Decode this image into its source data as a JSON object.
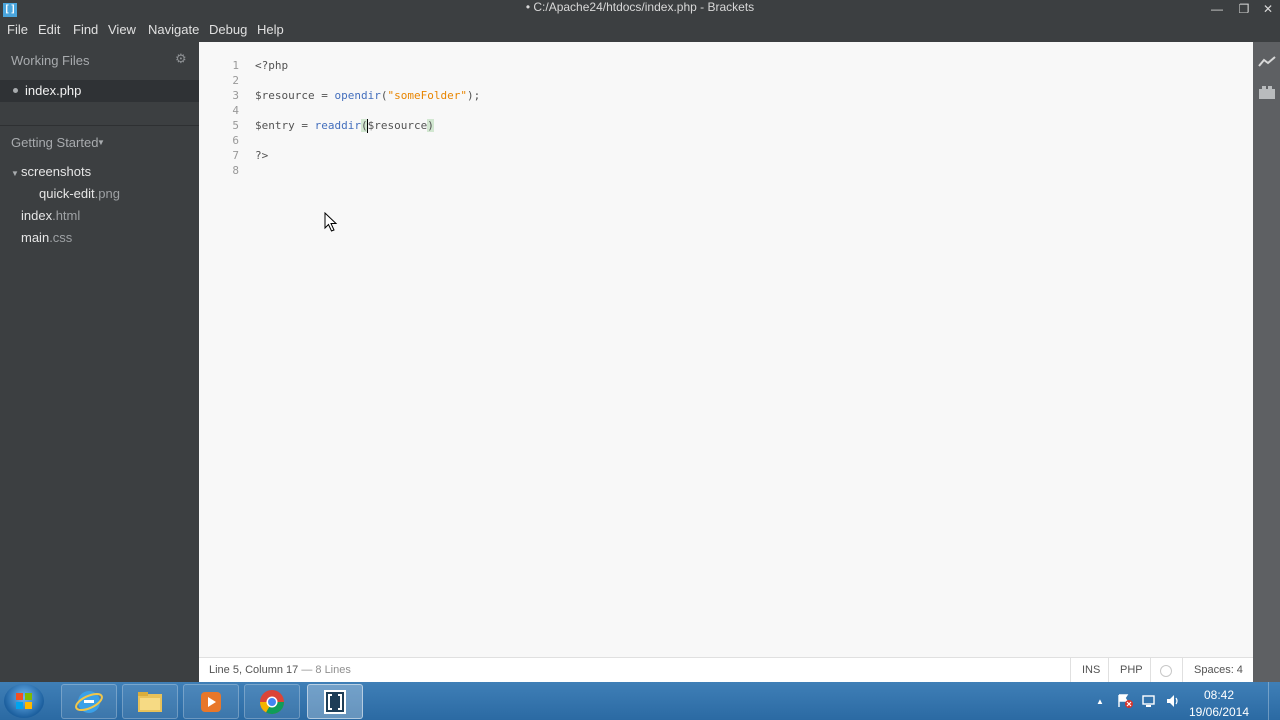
{
  "window": {
    "title": "• C:/Apache24/htdocs/index.php - Brackets",
    "logo_glyph": "[]",
    "minimize_glyph": "—",
    "maximize_glyph": "❐",
    "close_glyph": "✕"
  },
  "menu": [
    "File",
    "Edit",
    "Find",
    "View",
    "Navigate",
    "Debug",
    "Help"
  ],
  "sidebar": {
    "working_files_title": "Working Files",
    "gear_glyph": "⚙",
    "working_files": [
      {
        "name": "index.php",
        "selected": true
      }
    ],
    "project_title": "Getting Started",
    "project_caret": "▼",
    "tree": [
      {
        "base": "screenshots",
        "ext": "",
        "type": "folder",
        "caret": "▼"
      },
      {
        "base": "quick-edit",
        "ext": ".png",
        "type": "file"
      },
      {
        "base": "index",
        "ext": ".html",
        "type": "file"
      },
      {
        "base": "main",
        "ext": ".css",
        "type": "file"
      }
    ]
  },
  "editor": {
    "line_numbers": [
      "1",
      "2",
      "3",
      "4",
      "5",
      "6",
      "7",
      "8"
    ],
    "lines": {
      "l1": "<?php",
      "l3_var": "$resource",
      "l3_eq": " = ",
      "l3_fn": "opendir",
      "l3_open": "(",
      "l3_str": "\"someFolder\"",
      "l3_close": ");",
      "l5_var": "$entry",
      "l5_eq": " = ",
      "l5_fn": "readdir",
      "l5_open": "(",
      "l5_arg": "$resource",
      "l5_close": ")",
      "l7": "?>"
    }
  },
  "statusbar": {
    "position": "Line 5, Column 17",
    "lines": " — 8 Lines",
    "mode": "INS",
    "language": "PHP",
    "indent": "Spaces: 4"
  },
  "right_toolbar": {
    "live_preview_icon": "live-preview-icon",
    "extension_manager_icon": "extension-manager-icon"
  },
  "taskbar": {
    "apps": [
      "start-orb",
      "internet-explorer",
      "file-explorer",
      "media-player",
      "chrome",
      "brackets"
    ],
    "clock_time": "08:42",
    "clock_date": "19/06/2014",
    "tray_up_glyph": "▲"
  },
  "colors": {
    "sidebar_bg": "#3c3f41",
    "editor_bg": "#f8f8f8",
    "keyword": "#446fbd",
    "string": "#e88501",
    "taskbar": "#2b6aa3"
  }
}
